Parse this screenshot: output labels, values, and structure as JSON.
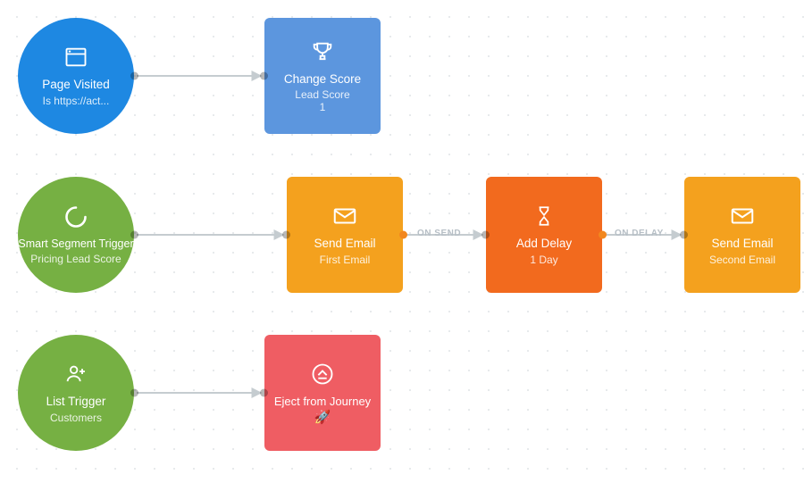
{
  "nodes": {
    "pageVisited": {
      "title": "Page Visited",
      "sub": "Is https://act..."
    },
    "changeScore": {
      "title": "Change Score",
      "sub": "Lead Score",
      "sub2": "1"
    },
    "smartSegment": {
      "title": "Smart Segment Trigger",
      "sub": "Pricing Lead Score"
    },
    "sendEmail1": {
      "title": "Send Email",
      "sub": "First Email"
    },
    "addDelay": {
      "title": "Add Delay",
      "sub": "1 Day"
    },
    "sendEmail2": {
      "title": "Send Email",
      "sub": "Second Email"
    },
    "listTrigger": {
      "title": "List Trigger",
      "sub": "Customers"
    },
    "eject": {
      "title": "Eject from Journey"
    }
  },
  "edgeLabels": {
    "onSend": "ON SEND",
    "onDelay": "ON DELAY"
  },
  "colors": {
    "arrow": "#c5ccd0",
    "blue": "#1e88e2",
    "green": "#76b043",
    "lblue": "#5c96de",
    "orange": "#f4a11e",
    "dorange": "#f26a1e",
    "red": "#ef5d63"
  }
}
